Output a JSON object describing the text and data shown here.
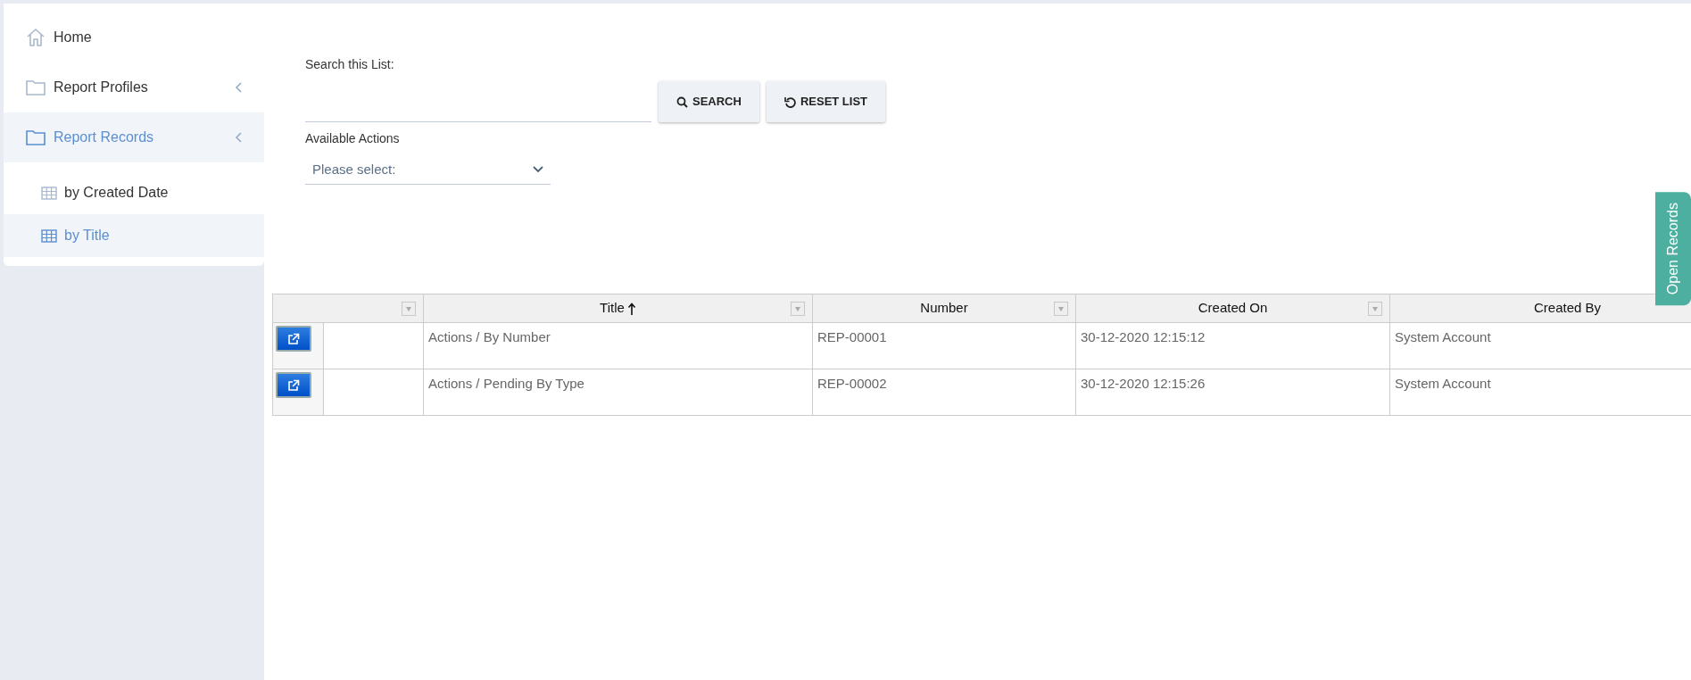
{
  "sidebar": {
    "items": [
      {
        "kind": "home",
        "label": "Home",
        "selected": false
      },
      {
        "kind": "folder",
        "label": "Report Profiles",
        "selected": false
      },
      {
        "kind": "folder",
        "label": "Report Records",
        "selected": true,
        "children": [
          {
            "kind": "view",
            "label": "by Created Date",
            "selected": false
          },
          {
            "kind": "view",
            "label": "by Title",
            "selected": true
          }
        ]
      }
    ]
  },
  "search": {
    "label": "Search this List:",
    "buttons": [
      {
        "kind": "search",
        "label": "SEARCH"
      },
      {
        "kind": "reset",
        "label": "RESET LIST"
      }
    ]
  },
  "actions": {
    "label": "Available Actions",
    "placeholder": "Please select:"
  },
  "table": {
    "columns": [
      {
        "filter": true,
        "sorted": false
      },
      {
        "label": "Title",
        "filter": true,
        "sorted": true
      },
      {
        "label": "Number",
        "filter": true,
        "sorted": false
      },
      {
        "label": "Created On",
        "filter": true,
        "sorted": false
      },
      {
        "label": "Created By",
        "sorted": false
      }
    ],
    "rows": [
      {
        "title": "Actions / By Number",
        "number": "REP-00001",
        "created_on": "30-12-2020 12:15:12",
        "created_by": "System Account"
      },
      {
        "title": "Actions / Pending By Type",
        "number": "REP-00002",
        "created_on": "30-12-2020 12:15:26",
        "created_by": "System Account"
      }
    ]
  },
  "side_tab": {
    "label": "Open Records"
  }
}
